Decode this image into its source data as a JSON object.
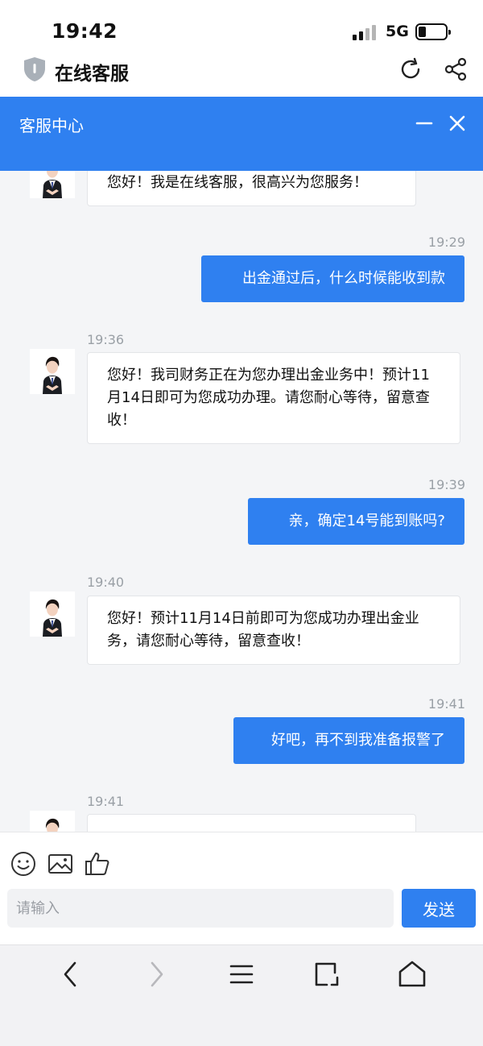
{
  "status_bar": {
    "time": "19:42",
    "network": "5G"
  },
  "app_header": {
    "title": "在线客服"
  },
  "chat_header": {
    "title": "客服中心"
  },
  "messages": [
    {
      "side": "in",
      "time": "",
      "text": "您好！我是在线客服，很高兴为您服务！"
    },
    {
      "side": "out",
      "time": "19:29",
      "text": "出金通过后，什么时候能收到款"
    },
    {
      "side": "in",
      "time": "19:36",
      "text": "您好！我司财务正在为您办理出金业务中！预计11月14日即可为您成功办理。请您耐心等待，留意查收！"
    },
    {
      "side": "out",
      "time": "19:39",
      "text": "亲，确定14号能到账吗?"
    },
    {
      "side": "in",
      "time": "19:40",
      "text": "您好！预计11月14日前即可为您成功办理出金业务，请您耐心等待，留意查收！"
    },
    {
      "side": "out",
      "time": "19:41",
      "text": "好吧，再不到我准备报警了"
    },
    {
      "side": "in",
      "time": "19:41",
      "text": ""
    }
  ],
  "input": {
    "placeholder": "请输入",
    "value": ""
  },
  "send_label": "发送",
  "colors": {
    "accent": "#2f80f0",
    "chat_bg": "#f4f5f7"
  }
}
